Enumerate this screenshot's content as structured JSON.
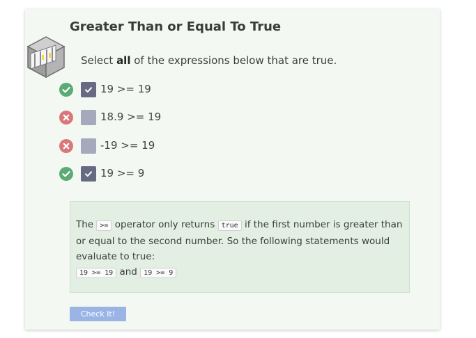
{
  "exercise": {
    "title": "Greater Than or Equal To True",
    "prompt_prefix": "Select",
    "prompt_bold": "all",
    "prompt_suffix": "of the expressions below that are true."
  },
  "options": [
    {
      "label": "19 >= 19",
      "checked": true,
      "status": "correct",
      "status_icon": "check-circle-icon"
    },
    {
      "label": "18.9 >= 19",
      "checked": false,
      "status": "incorrect",
      "status_icon": "x-circle-icon"
    },
    {
      "label": "-19 >= 19",
      "checked": false,
      "status": "incorrect",
      "status_icon": "x-circle-icon"
    },
    {
      "label": "19 >= 9",
      "checked": true,
      "status": "correct",
      "status_icon": "check-circle-icon"
    }
  ],
  "explanation": {
    "part1": "The",
    "code_operator": ">=",
    "part2": "operator only returns",
    "code_true": "true",
    "part3": "if the first number is greater than or equal to the second number. So the following statements would evaluate to true:",
    "code_example1": "19 >= 19",
    "joiner": "and",
    "code_example2": "19 >= 9"
  },
  "check_button": {
    "label": "Check It!"
  },
  "colors": {
    "correct": "#5aab74",
    "incorrect": "#d9787b",
    "checkbox_checked": "#666a83",
    "checkbox_unchecked": "#a6a8bc",
    "button": "#9bb4e6",
    "feedback_bg": "#e2efe2"
  }
}
